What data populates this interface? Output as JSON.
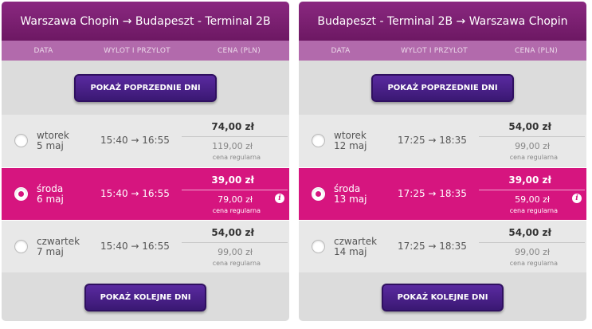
{
  "panels": [
    {
      "title": "Warszawa Chopin → Budapeszt - Terminal 2B",
      "headers": {
        "date": "DATA",
        "time": "WYLOT I PRZYLOT",
        "price": "CENA (PLN)"
      },
      "prev_label": "POKAŻ POPRZEDNIE DNI",
      "next_label": "POKAŻ KOLEJNE DNI",
      "rows": [
        {
          "day": "wtorek",
          "date": "5 maj",
          "times": "15:40 → 16:55",
          "price": "74,00 zł",
          "regular": "119,00 zł",
          "note": "cena regularna",
          "selected": false
        },
        {
          "day": "środa",
          "date": "6 maj",
          "times": "15:40 → 16:55",
          "price": "39,00 zł",
          "regular": "79,00 zł",
          "note": "cena regularna",
          "selected": true
        },
        {
          "day": "czwartek",
          "date": "7 maj",
          "times": "15:40 → 16:55",
          "price": "54,00 zł",
          "regular": "99,00 zł",
          "note": "cena regularna",
          "selected": false
        }
      ]
    },
    {
      "title": "Budapeszt - Terminal 2B → Warszawa Chopin",
      "headers": {
        "date": "DATA",
        "time": "WYLOT I PRZYLOT",
        "price": "CENA (PLN)"
      },
      "prev_label": "POKAŻ POPRZEDNIE DNI",
      "next_label": "POKAŻ KOLEJNE DNI",
      "rows": [
        {
          "day": "wtorek",
          "date": "12 maj",
          "times": "17:25 → 18:35",
          "price": "54,00 zł",
          "regular": "99,00 zł",
          "note": "cena regularna",
          "selected": false
        },
        {
          "day": "środa",
          "date": "13 maj",
          "times": "17:25 → 18:35",
          "price": "39,00 zł",
          "regular": "59,00 zł",
          "note": "cena regularna",
          "selected": true
        },
        {
          "day": "czwartek",
          "date": "14 maj",
          "times": "17:25 → 18:35",
          "price": "54,00 zł",
          "regular": "99,00 zł",
          "note": "cena regularna",
          "selected": false
        }
      ]
    }
  ],
  "info_icon": "i",
  "colors": {
    "brand": "#6d1863",
    "selected": "#d6157f",
    "button": "#3a1873"
  },
  "icons": {
    "info": "info-icon",
    "radio": "radio-button"
  }
}
